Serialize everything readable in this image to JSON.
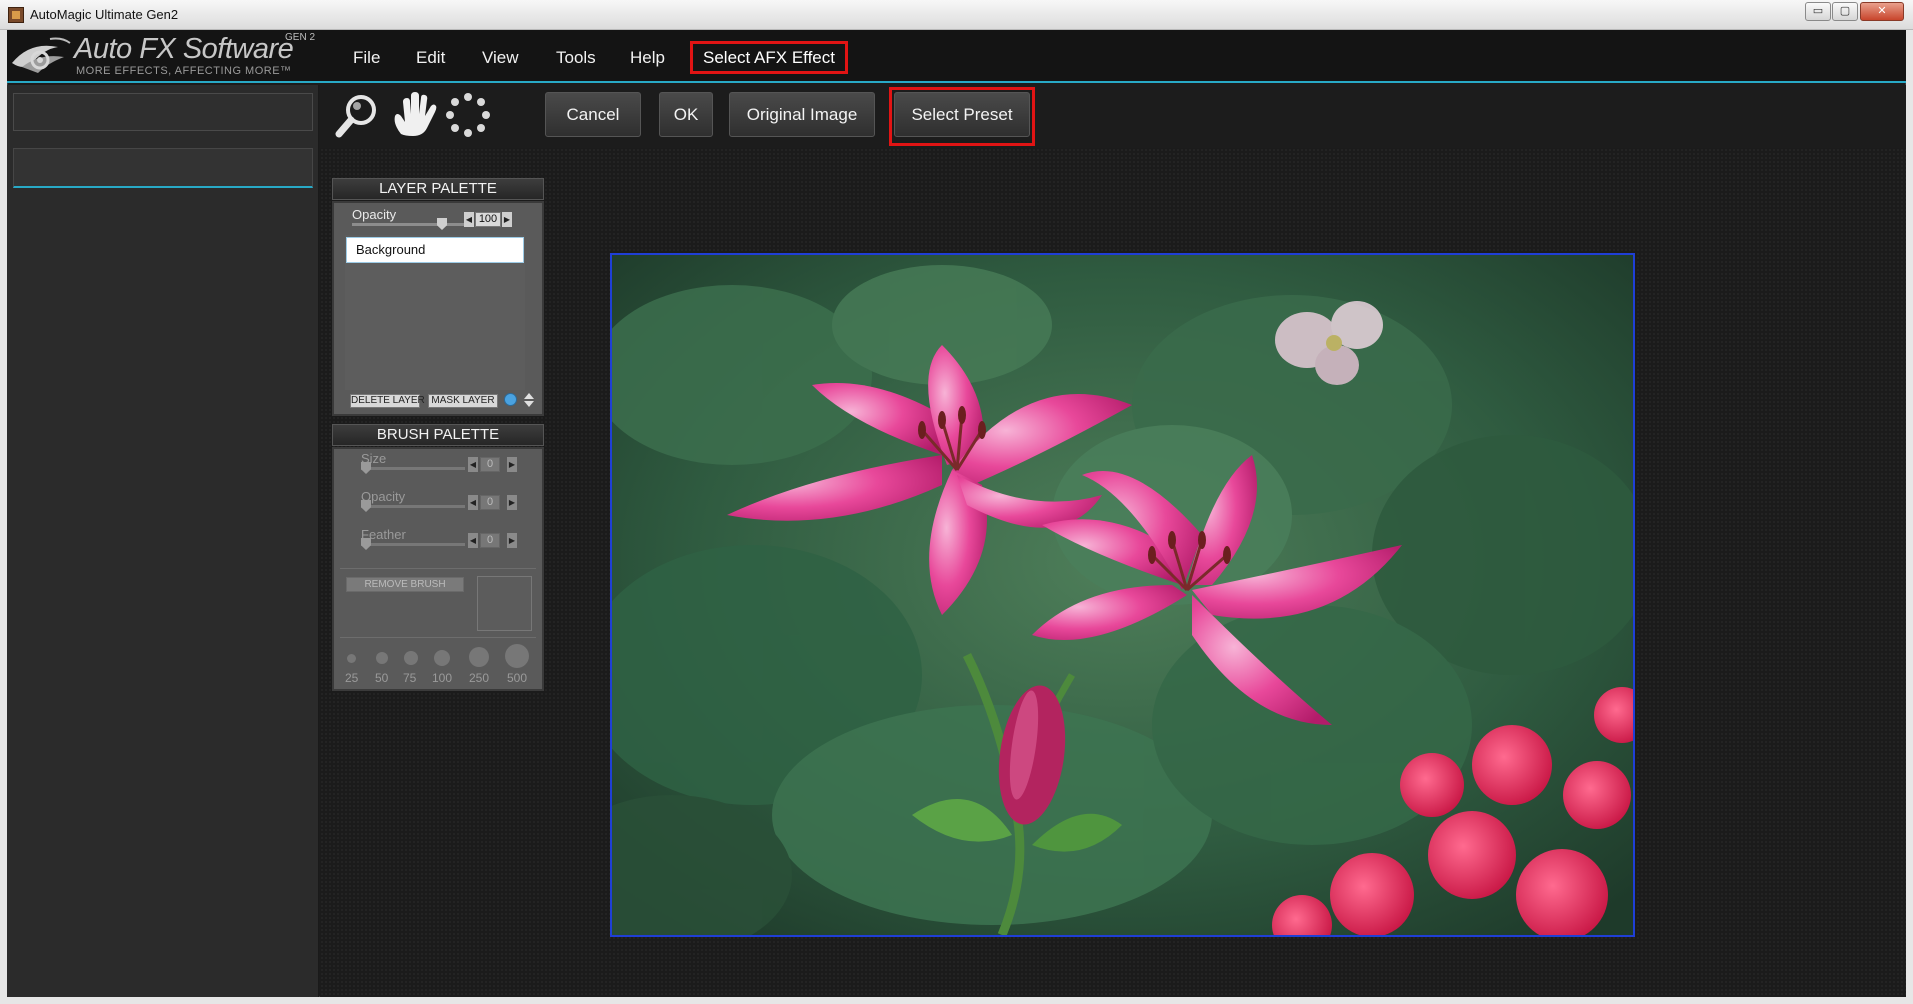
{
  "window": {
    "title": "AutoMagic Ultimate Gen2",
    "controls": {
      "minimize": "▭",
      "maximize": "▢",
      "close": "✕"
    }
  },
  "logo": {
    "name": "Auto FX Software",
    "tagline": "MORE EFFECTS, AFFECTING MORE™",
    "badge": "GEN 2"
  },
  "menu": {
    "file": "File",
    "edit": "Edit",
    "view": "View",
    "tools": "Tools",
    "help": "Help",
    "select_afx_effect": "Select AFX Effect"
  },
  "toolbar": {
    "icons": [
      "magnifier-icon",
      "hand-icon",
      "selection-ring-icon"
    ],
    "cancel": "Cancel",
    "ok": "OK",
    "original_image": "Original Image",
    "select_preset": "Select Preset"
  },
  "layer_palette": {
    "title": "LAYER PALETTE",
    "opacity_label": "Opacity",
    "opacity_value": "100",
    "opacity_fraction": 0.8,
    "layers": [
      "Background"
    ],
    "delete_layer": "DELETE LAYER",
    "mask_layer": "MASK LAYER"
  },
  "brush_palette": {
    "title": "BRUSH PALETTE",
    "size_label": "Size",
    "size_value": "0",
    "opacity_label": "Opacity",
    "opacity_value": "0",
    "feather_label": "Feather",
    "feather_value": "0",
    "remove_brush": "REMOVE BRUSH",
    "brush_sizes": [
      "25",
      "50",
      "75",
      "100",
      "250",
      "500"
    ]
  },
  "colors": {
    "accent": "#28a9c6",
    "highlight_outline": "#e11414",
    "image_border": "#1f3fd6"
  }
}
